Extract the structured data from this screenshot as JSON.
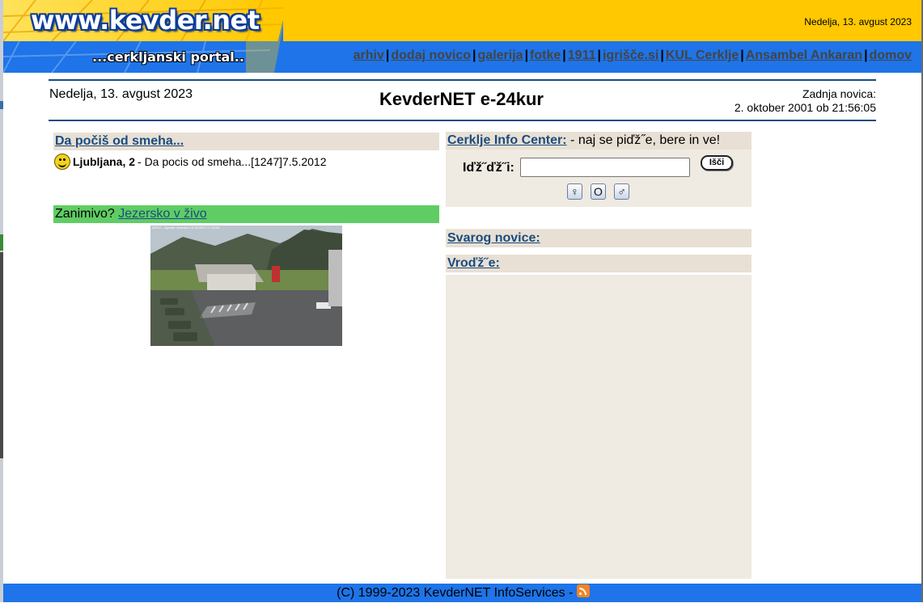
{
  "header": {
    "logo_title": "www.kevder.net",
    "logo_subtitle": "...cerkljanski portal..",
    "date": "Nedelja, 13. avgust 2023",
    "nav": [
      "arhiv",
      "dodaj novico",
      "galerija",
      "fotke",
      "1911",
      "igrišče.si",
      "KUL Cerklje",
      "Ansambel Ankaran",
      "domov"
    ]
  },
  "subheader": {
    "date": "Nedelja, 13. avgust 2023",
    "title": "KevderNET e-24kur",
    "last_news_label": "Zadnja novica:",
    "last_news_value": "2. oktober 2001 ob 21:56:05"
  },
  "left": {
    "section_title": "Da počiš od smeha...",
    "news_city": "Ljubljana, 2",
    "news_text": "- Da pocis od smeha...[1247]7.5.2012",
    "interesting_label": "Zanimivo?",
    "interesting_link": "Jezersko v živo",
    "webcam_caption": "ARSO - Zgornje Jezersko 13.08.2023 17:15:00"
  },
  "right": {
    "info_link": "Cerklje Info Center:",
    "info_text": " - naj se piďž˝e, bere in ve!",
    "search_label": "Iďž˝ďž˝i:",
    "search_value": "",
    "search_button": "Išči",
    "symbols": [
      "♀",
      "O",
      "♂"
    ],
    "section_svarog": "Svarog novice:",
    "section_vroce": "Vroďž˝e:"
  },
  "footer": {
    "text": "(C) 1999-2023 KevderNET InfoServices - "
  },
  "colors": {
    "header_yellow": "#ffc800",
    "header_blue": "#1e74e8",
    "panel_beige": "#e8e0d4",
    "green_bar": "#5fcd64",
    "link_blue": "#1a4c80"
  }
}
